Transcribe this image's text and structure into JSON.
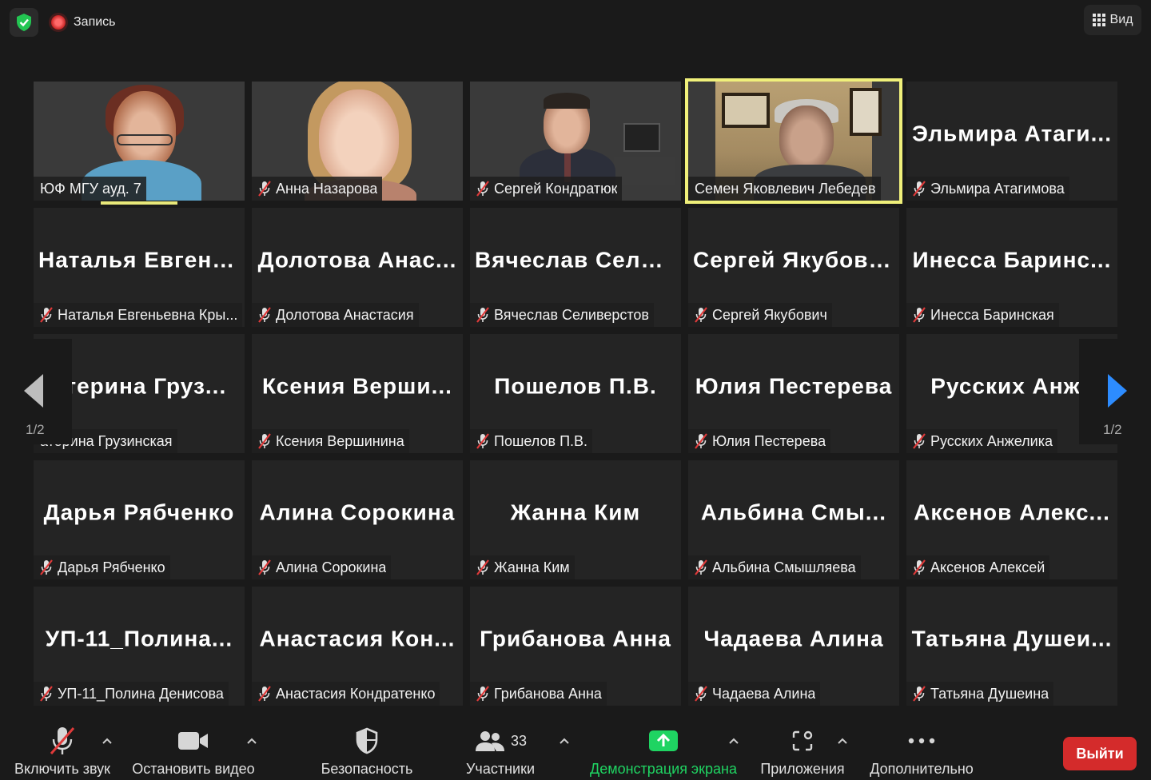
{
  "topbar": {
    "recording_label": "Запись",
    "view_label": "Вид"
  },
  "tiles": [
    {
      "big": "",
      "name": "ЮФ МГУ ауд. 7",
      "muted": false
    },
    {
      "big": "",
      "name": "Анна Назарова",
      "muted": true
    },
    {
      "big": "",
      "name": "Сергей Кондратюк",
      "muted": true
    },
    {
      "big": "",
      "name": "Семен Яковлевич Лебедев",
      "muted": false
    },
    {
      "big": "Эльмира Атаги...",
      "name": "Эльмира Атагимова",
      "muted": true
    },
    {
      "big": "Наталья Евгень...",
      "name": "Наталья Евгеньевна Кры...",
      "muted": true
    },
    {
      "big": "Долотова Анас...",
      "name": "Долотова Анастасия",
      "muted": true
    },
    {
      "big": "Вячеслав Сели...",
      "name": "Вячеслав Селиверстов",
      "muted": true
    },
    {
      "big": "Сергей Якубович",
      "name": "Сергей Якубович",
      "muted": true
    },
    {
      "big": "Инесса Баринс...",
      "name": "Инесса Баринская",
      "muted": true
    },
    {
      "big": "атерина Груз...",
      "name": "атерина Грузинская",
      "muted": false
    },
    {
      "big": "Ксения Верши...",
      "name": "Ксения Вершинина",
      "muted": true
    },
    {
      "big": "Пошелов П.В.",
      "name": "Пошелов П.В.",
      "muted": true
    },
    {
      "big": "Юлия Пестерева",
      "name": "Юлия Пестерева",
      "muted": true
    },
    {
      "big": "Русских Анже",
      "name": "Русских Анжелика",
      "muted": true
    },
    {
      "big": "Дарья Рябченко",
      "name": "Дарья Рябченко",
      "muted": true
    },
    {
      "big": "Алина Сорокина",
      "name": "Алина Сорокина",
      "muted": true
    },
    {
      "big": "Жанна Ким",
      "name": "Жанна Ким",
      "muted": true
    },
    {
      "big": "Альбина Смы...",
      "name": "Альбина Смышляева",
      "muted": true
    },
    {
      "big": "Аксенов Алекс...",
      "name": "Аксенов Алексей",
      "muted": true
    },
    {
      "big": "УП-11_Полина...",
      "name": "УП-11_Полина Денисова",
      "muted": true
    },
    {
      "big": "Анастасия Кон...",
      "name": "Анастасия Кондратенко",
      "muted": true
    },
    {
      "big": "Грибанова Анна",
      "name": "Грибанова Анна",
      "muted": true
    },
    {
      "big": "Чадаева Алина",
      "name": "Чадаева Алина",
      "muted": true
    },
    {
      "big": "Татьяна Душеи...",
      "name": "Татьяна Душеина",
      "muted": true
    }
  ],
  "pager": {
    "left": "1/2",
    "right": "1/2"
  },
  "toolbar": {
    "unmute_label": "Включить звук",
    "stop_video_label": "Остановить видео",
    "security_label": "Безопасность",
    "participants_label": "Участники",
    "participants_count": "33",
    "share_label": "Демонстрация экрана",
    "apps_label": "Приложения",
    "more_label": "Дополнительно",
    "exit_label": "Выйти"
  },
  "colors": {
    "accent_blue": "#2d8cff",
    "share_green": "#1fd462",
    "exit_red": "#d42b2b",
    "active_speaker": "#f0f07a"
  }
}
